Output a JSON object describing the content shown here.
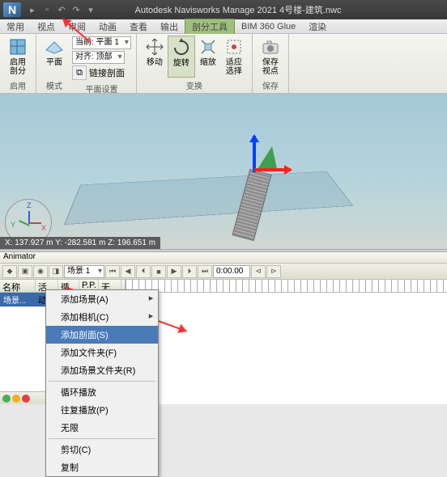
{
  "title": "Autodesk Navisworks Manage 2021    4号楼-建筑.nwc",
  "logo": "N",
  "tabs": [
    "常用",
    "视点",
    "审阅",
    "动画",
    "查看",
    "输出",
    "剖分工具",
    "BIM 360 Glue",
    "渲染"
  ],
  "active_tab": "剖分工具",
  "ribbon": {
    "p1": {
      "btn": "启用\n剖分",
      "title": "启用"
    },
    "p2": {
      "btn": "平面",
      "title": "模式",
      "lbl_plane": "当前: 平面 1",
      "lbl_align": "对齐: 顶部",
      "link": "链接剖面",
      "ps_title": "平面设置"
    },
    "p3": {
      "move": "移动",
      "rotate": "旋转",
      "scale": "缩放",
      "fit": "适应\n选择",
      "title": "变换"
    },
    "p4": {
      "save": "保存\n视点",
      "title": "保存"
    }
  },
  "coords": "X: 137.927 m  Y: -282.581 m  Z: 196.651 m",
  "vc": {
    "x": "X",
    "y": "Y",
    "z": "Z"
  },
  "animator": {
    "title": "Animator",
    "scene": "场景 1",
    "time": "0:00.00",
    "columns": [
      "名称",
      "活动",
      "循...",
      "P.P.",
      "无限"
    ],
    "root": "场景..."
  },
  "menu": {
    "add_scene": "添加场景(A)",
    "add_camera": "添加相机(C)",
    "add_section": "添加剖面(S)",
    "add_folder": "添加文件夹(F)",
    "add_scene_folder": "添加场景文件夹(R)",
    "loop": "循环播放",
    "pingpong": "往复播放(P)",
    "infinite": "无限",
    "cut": "剪切(C)",
    "copy": "复制"
  }
}
